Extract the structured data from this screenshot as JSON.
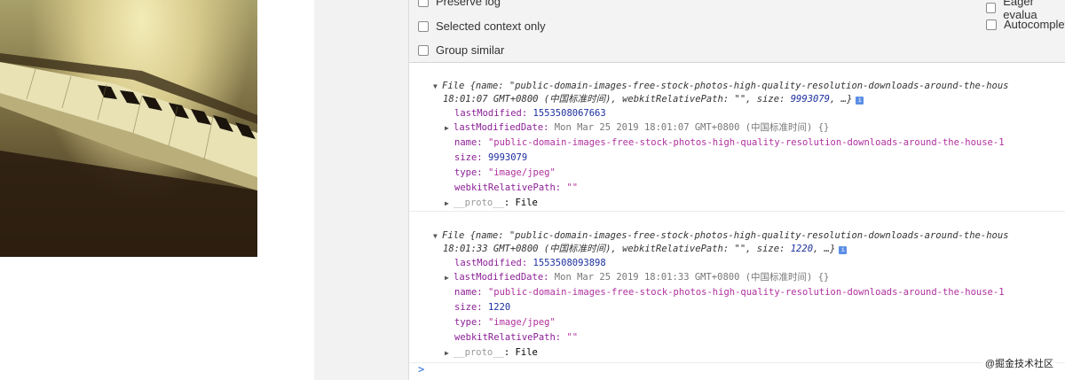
{
  "settings": {
    "preserve_log": "Preserve log",
    "selected_context": "Selected context only",
    "group_similar": "Group similar",
    "eager_eval": "Eager evalua",
    "autocomplete": "Autocomplet"
  },
  "entries": [
    {
      "summary_1": "File {name: \"public-domain-images-free-stock-photos-high-quality-resolution-downloads-around-the-hous",
      "summary_2a": "18:01:07 GMT+0800 (中国标准时间), webkitRelativePath: \"\", size: ",
      "summary_size": "9993079",
      "summary_2b": ", …}",
      "last_modified_key": "lastModified:",
      "last_modified_val": "1553508067663",
      "last_modified_date_key": "lastModifiedDate:",
      "last_modified_date_val": "Mon Mar 25 2019 18:01:07 GMT+0800 (中国标准时间) {}",
      "name_key": "name:",
      "name_val": "\"public-domain-images-free-stock-photos-high-quality-resolution-downloads-around-the-house-1",
      "size_key": "size:",
      "size_val": "9993079",
      "type_key": "type:",
      "type_val": "\"image/jpeg\"",
      "wrp_key": "webkitRelativePath:",
      "wrp_val": "\"\"",
      "proto_key": "__proto__",
      "proto_val": ": File"
    },
    {
      "summary_1": "File {name: \"public-domain-images-free-stock-photos-high-quality-resolution-downloads-around-the-hous",
      "summary_2a": "18:01:33 GMT+0800 (中国标准时间), webkitRelativePath: \"\", size: ",
      "summary_size": "1220",
      "summary_2b": ", …}",
      "last_modified_key": "lastModified:",
      "last_modified_val": "1553508093898",
      "last_modified_date_key": "lastModifiedDate:",
      "last_modified_date_val": "Mon Mar 25 2019 18:01:33 GMT+0800 (中国标准时间) {}",
      "name_key": "name:",
      "name_val": "\"public-domain-images-free-stock-photos-high-quality-resolution-downloads-around-the-house-1",
      "size_key": "size:",
      "size_val": "1220",
      "type_key": "type:",
      "type_val": "\"image/jpeg\"",
      "wrp_key": "webkitRelativePath:",
      "wrp_val": "\"\"",
      "proto_key": "__proto__",
      "proto_val": ": File"
    }
  ],
  "prompt_symbol": ">",
  "watermark": "@掘金技术社区",
  "icons": [
    "expand-triangle-icon",
    "info-icon",
    "checkbox-icon",
    "console-prompt-icon"
  ],
  "colors": {
    "string": "#b0309e",
    "number": "#1c2f9e",
    "key": "#8b1f96",
    "prompt": "#2a6fd6"
  }
}
